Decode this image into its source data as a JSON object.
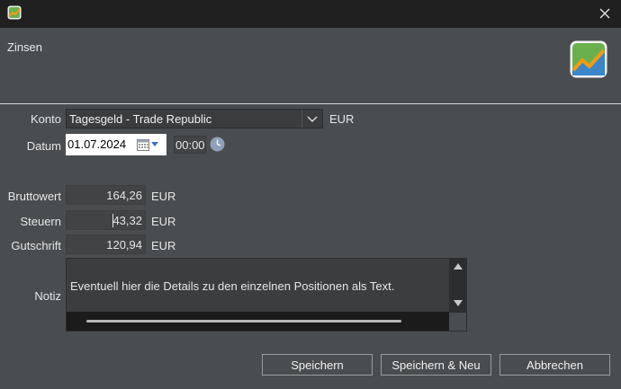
{
  "dialog": {
    "title": "Zinsen"
  },
  "form": {
    "konto_label": "Konto",
    "konto_value": "Tagesgeld - Trade Republic",
    "konto_currency": "EUR",
    "datum_label": "Datum",
    "datum_value": "01.07.2024",
    "time_value": "00:00",
    "brutto_label": "Bruttowert",
    "brutto_value": "164,26",
    "brutto_currency": "EUR",
    "steuern_label": "Steuern",
    "steuern_value": "43,32",
    "steuern_currency": "EUR",
    "gutschrift_label": "Gutschrift",
    "gutschrift_value": "120,94",
    "gutschrift_currency": "EUR",
    "notiz_label": "Notiz",
    "notiz_value": "Eventuell hier die Details zu den einzelnen Positionen als Text."
  },
  "buttons": {
    "save": "Speichern",
    "save_new": "Speichern & Neu",
    "cancel": "Abbrechen"
  },
  "icons": {
    "app": "app-logo-icon",
    "close": "close-icon",
    "calendar": "calendar-icon",
    "clock": "clock-icon"
  }
}
